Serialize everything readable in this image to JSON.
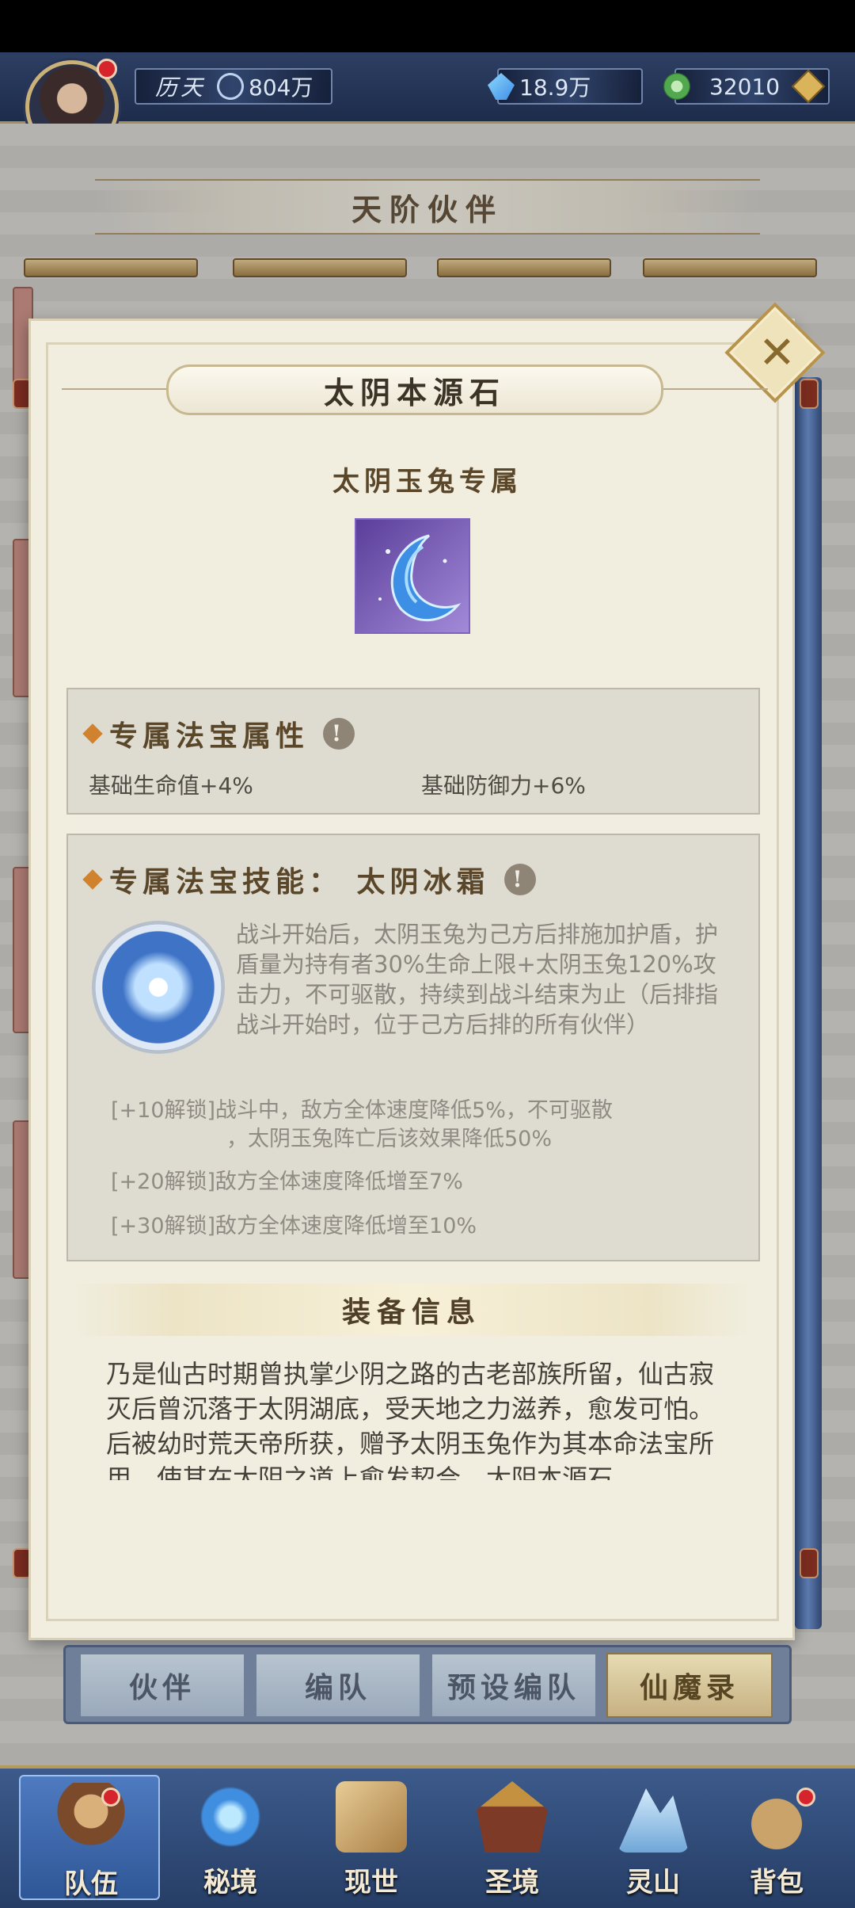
{
  "hud": {
    "history_label": "历天",
    "power": "804万",
    "crystals": "18.9万",
    "jade": "32010"
  },
  "page_title": "天阶伙伴",
  "modal": {
    "item_name": "太阴本源石",
    "owner_line": "太阴玉兔专属",
    "attr_section": {
      "heading": "专属法宝属性",
      "info_icon": "!",
      "attrs": [
        "基础生命值+4%",
        "基础防御力+6%"
      ]
    },
    "skill_section": {
      "heading": "专属法宝技能：  太阴冰霜",
      "info_icon": "!",
      "description": "战斗开始后，太阴玉兔为己方后排施加护盾，护盾量为持有者30%生命上限+太阴玉兔120%攻击力，不可驱散，持续到战斗结束为止（后排指战斗开始时，位于己方后排的所有伙伴）",
      "unlock_10_line1": "[+10解锁]战斗中，敌方全体速度降低5%，不可驱散",
      "unlock_10_line2": "，太阴玉兔阵亡后该效果降低50%",
      "unlock_20": "[+20解锁]敌方全体速度降低增至7%",
      "unlock_30": "[+30解锁]敌方全体速度降低增至10%"
    },
    "equip_title": "装备信息",
    "equip_text": "乃是仙古时期曾执掌少阴之路的古老部族所留，仙古寂灭后曾沉落于太阴湖底，受天地之力滋养，愈发可怕。后被幼时荒天帝所获，赠予太阴玉兔作为其本命法宝所用，使其在太阴之道上愈发契合，太阴本源石"
  },
  "tabs": [
    {
      "label": "伙伴",
      "active": false
    },
    {
      "label": "编队",
      "active": false
    },
    {
      "label": "预设编队",
      "active": false
    },
    {
      "label": "仙魔录",
      "active": true
    }
  ],
  "bottom_nav": [
    {
      "label": "队伍",
      "icon": "team-icon",
      "active": true
    },
    {
      "label": "秘境",
      "icon": "secret-realm-icon",
      "active": false
    },
    {
      "label": "现世",
      "icon": "present-world-icon",
      "active": false
    },
    {
      "label": "圣境",
      "icon": "holy-realm-icon",
      "active": false
    },
    {
      "label": "灵山",
      "icon": "spirit-mountain-icon",
      "active": false
    },
    {
      "label": "背包",
      "icon": "backpack-icon",
      "active": false
    }
  ],
  "colors": {
    "parchment": "#f1eee0",
    "brown_text": "#5a4629",
    "accent_orange": "#d0822f",
    "nav_blue": "#2f5797",
    "notice_red": "#d6242d"
  }
}
